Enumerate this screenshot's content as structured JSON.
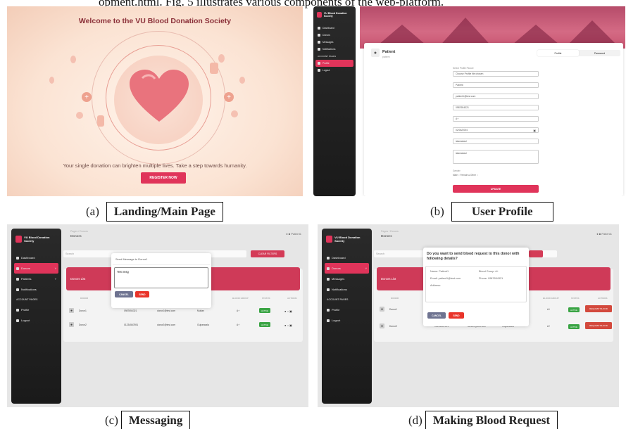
{
  "top_text": "opment.html. Fig. 5 illustrates various components of the web-platform.",
  "captions": [
    {
      "letter": "(a)",
      "title": "Landing/Main Page"
    },
    {
      "letter": "(b)",
      "title": "User Profile"
    },
    {
      "letter": "(c)",
      "title": "Messaging"
    },
    {
      "letter": "(d)",
      "title": "Making Blood Request"
    }
  ],
  "landing": {
    "welcome": "Welcome to the VU Blood Donation Society",
    "tagline": "Your single donation can brighten multiple lives. Take a step towards humanity.",
    "register_label": "REGISTER NOW"
  },
  "sidebar": {
    "logo_text": "VU Blood Donation Society",
    "items": [
      {
        "label": "Dashboard",
        "icon": "dashboard-icon"
      },
      {
        "label": "Donors",
        "icon": "heart-icon"
      },
      {
        "label": "Patients",
        "icon": "person-icon"
      },
      {
        "label": "Messages",
        "icon": "message-icon"
      },
      {
        "label": "Notifications",
        "icon": "bell-icon"
      },
      {
        "label": "ACCOUNT PAGES"
      },
      {
        "label": "Profile",
        "icon": "person-icon"
      },
      {
        "label": "Logout",
        "icon": "logout-icon"
      }
    ]
  },
  "profile": {
    "name": "Patient",
    "role": "patient",
    "tabs": [
      "Profile",
      "Password"
    ],
    "picture_label": "Select Profile Picture",
    "file_field": "Choose Profile file chosen",
    "fields": [
      "Patient",
      "patient1@test.com",
      "0987654321",
      "A+",
      "02/04/2004",
      "islamabad",
      "islamabad"
    ],
    "gender_label": "Gender",
    "gender_options": "Male ○  Female ●  Other ○",
    "update_label": "UPDATE"
  },
  "donors_page": {
    "crumb": "Pages / Donors",
    "title": "Donors",
    "user": "Patient1",
    "search_placeholder": "Search",
    "clear_label": "CLEAR FILTERS",
    "list_title": "Donors List",
    "columns": [
      "DONOR",
      "CONTACT",
      "EMAIL",
      "ADDRESS",
      "BLOOD GROUP",
      "STATUS",
      "ACTIONS"
    ],
    "rows": [
      {
        "name": "Donor1",
        "contact": "0987654321",
        "email": "donor1@test.com",
        "address": "Multan",
        "blood": "A+",
        "status": "ACTIVE"
      },
      {
        "name": "Donor2",
        "contact": "01234567891",
        "email": "donor2@test.com",
        "address": "Gujranwala",
        "blood": "A+",
        "status": "ACTIVE"
      }
    ],
    "request_label": "REQUEST BLOOD"
  },
  "message_modal": {
    "title": "Send Message to Donor1",
    "text": "Test msg",
    "cancel": "CANCEL",
    "send": "SEND"
  },
  "request_modal": {
    "title": "Do you want to send blood request to this donor with following details?",
    "name": "Name: Patient1",
    "blood": "Blood Group: A+",
    "email": "Email: patient1@test.com",
    "phone": "Phone: 0987654321",
    "address": "Address:",
    "cancel": "CANCEL",
    "send": "SEND"
  },
  "colors": {
    "brand": "#e0345a",
    "status_active": "#3aa444",
    "request_btn": "#d3493d"
  }
}
